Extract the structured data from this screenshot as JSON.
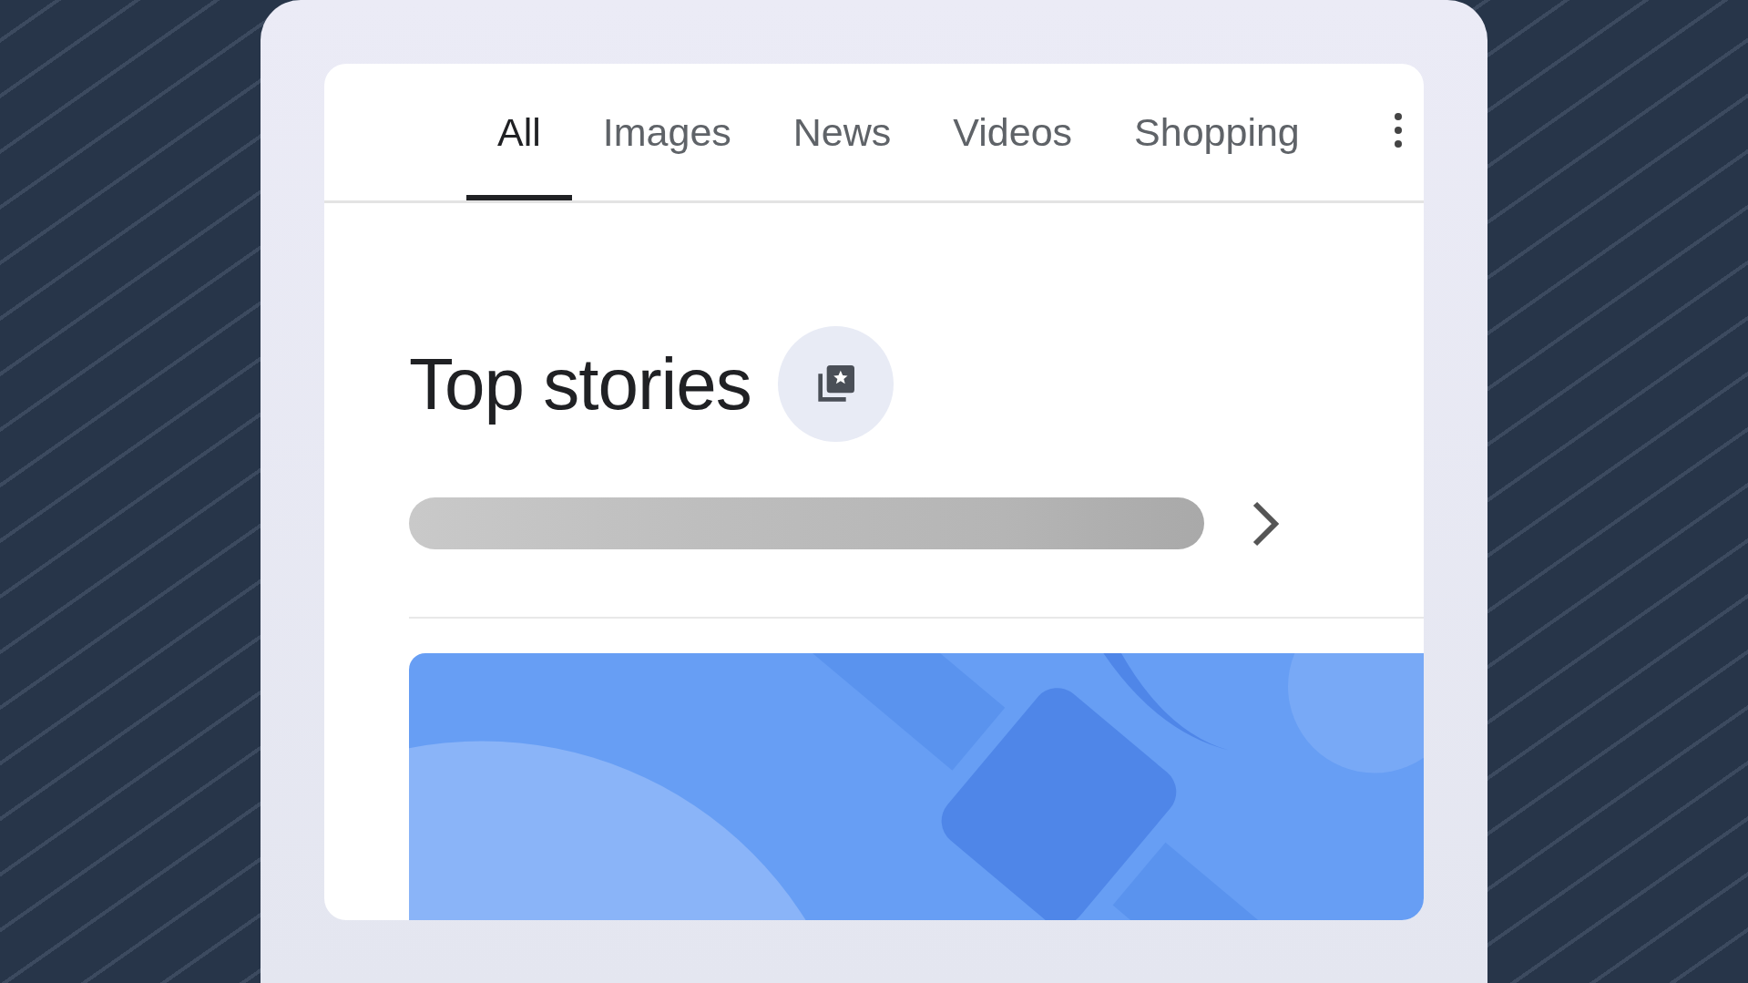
{
  "tabs": [
    {
      "label": "All",
      "selected": true
    },
    {
      "label": "Images",
      "selected": false
    },
    {
      "label": "News",
      "selected": false
    },
    {
      "label": "Videos",
      "selected": false
    },
    {
      "label": "Shopping",
      "selected": false
    }
  ],
  "section": {
    "title": "Top stories"
  }
}
